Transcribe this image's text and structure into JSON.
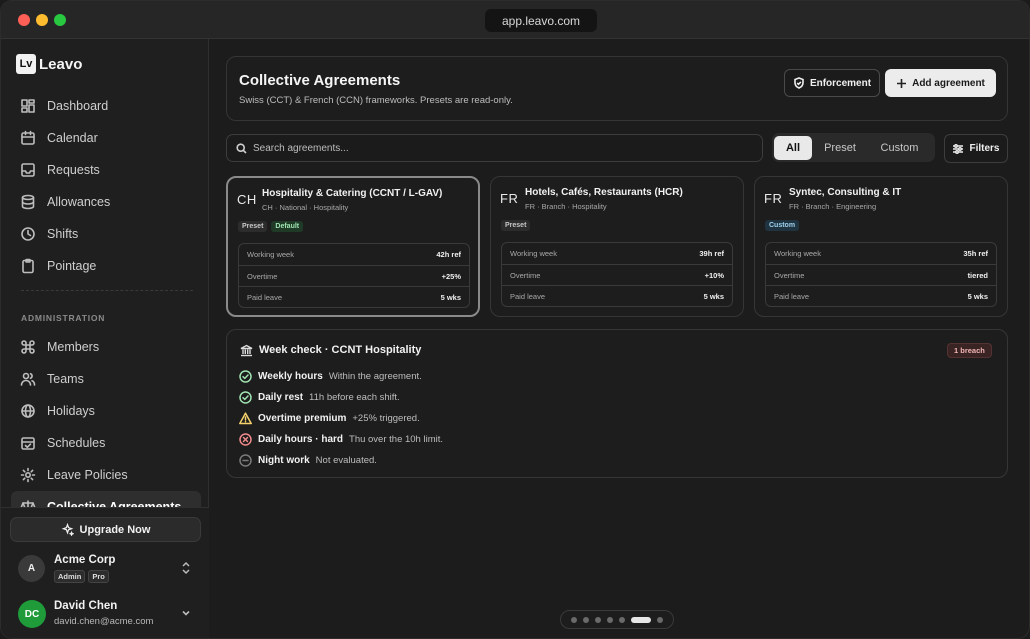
{
  "window": {
    "url": "app.leavo.com"
  },
  "brand": {
    "mark": "Lv",
    "name": "Leavo"
  },
  "sidebar": {
    "nav": [
      {
        "label": "Dashboard",
        "icon": "dashboard-icon"
      },
      {
        "label": "Calendar",
        "icon": "calendar-icon"
      },
      {
        "label": "Requests",
        "icon": "inbox-icon"
      },
      {
        "label": "Allowances",
        "icon": "database-icon"
      },
      {
        "label": "Shifts",
        "icon": "clock-icon"
      },
      {
        "label": "Pointage",
        "icon": "clipboard-icon"
      }
    ],
    "section_label": "ADMINISTRATION",
    "admin": [
      {
        "label": "Members",
        "icon": "command-icon"
      },
      {
        "label": "Teams",
        "icon": "users-icon"
      },
      {
        "label": "Holidays",
        "icon": "globe-icon"
      },
      {
        "label": "Schedules",
        "icon": "calendar-check-icon"
      },
      {
        "label": "Leave Policies",
        "icon": "gear-icon"
      },
      {
        "label": "Collective Agreements",
        "icon": "scale-icon"
      }
    ],
    "upgrade_label": "Upgrade Now",
    "org": {
      "initial": "A",
      "name": "Acme Corp",
      "badges": [
        "Admin",
        "Pro"
      ]
    },
    "user": {
      "initials": "DC",
      "name": "David Chen",
      "email": "david.chen@acme.com",
      "avatar_color": "#1f9b3a"
    }
  },
  "header": {
    "title": "Collective Agreements",
    "subtitle": "Swiss (CCT) & French (CCN) frameworks. Presets are read-only.",
    "enforcement_label": "Enforcement",
    "add_label": "Add agreement"
  },
  "search": {
    "placeholder": "Search agreements..."
  },
  "filter_tabs": [
    "All",
    "Preset",
    "Custom"
  ],
  "filters_label": "Filters",
  "agreements": [
    {
      "country": "CH",
      "title": "Hospitality & Catering (CCNT / L-GAV)",
      "meta": "CH · National · Hospitality",
      "tags": [
        "Preset",
        "Default"
      ],
      "stats": [
        {
          "label": "Working week",
          "value": "42h ref"
        },
        {
          "label": "Overtime",
          "value": "+25%"
        },
        {
          "label": "Paid leave",
          "value": "5 wks"
        }
      ]
    },
    {
      "country": "FR",
      "title": "Hotels, Cafés, Restaurants (HCR)",
      "meta": "FR · Branch · Hospitality",
      "tags": [
        "Preset"
      ],
      "stats": [
        {
          "label": "Working week",
          "value": "39h ref"
        },
        {
          "label": "Overtime",
          "value": "+10%"
        },
        {
          "label": "Paid leave",
          "value": "5 wks"
        }
      ]
    },
    {
      "country": "FR",
      "title": "Syntec, Consulting & IT",
      "meta": "FR · Branch · Engineering",
      "tags": [
        "Custom"
      ],
      "stats": [
        {
          "label": "Working week",
          "value": "35h ref"
        },
        {
          "label": "Overtime",
          "value": "tiered"
        },
        {
          "label": "Paid leave",
          "value": "5 wks"
        }
      ]
    }
  ],
  "week_check": {
    "title": "Week check · CCNT Hospitality",
    "badge": "1 breach",
    "items": [
      {
        "label": "Weekly hours",
        "detail": "Within the agreement.",
        "status": "ok"
      },
      {
        "label": "Daily rest",
        "detail": "11h before each shift.",
        "status": "ok"
      },
      {
        "label": "Overtime premium",
        "detail": "+25% triggered.",
        "status": "warn"
      },
      {
        "label": "Daily hours · hard",
        "detail": "Thu over the 10h limit.",
        "status": "error"
      },
      {
        "label": "Night work",
        "detail": "Not evaluated.",
        "status": "none"
      }
    ]
  },
  "colors": {
    "ok": "#9fe3b0",
    "warn": "#f5d26b",
    "error": "#f08a8a",
    "none": "#7a7a7a",
    "accent": "#e9e9e9"
  },
  "pager": {
    "count": 6,
    "active_index": 5
  }
}
